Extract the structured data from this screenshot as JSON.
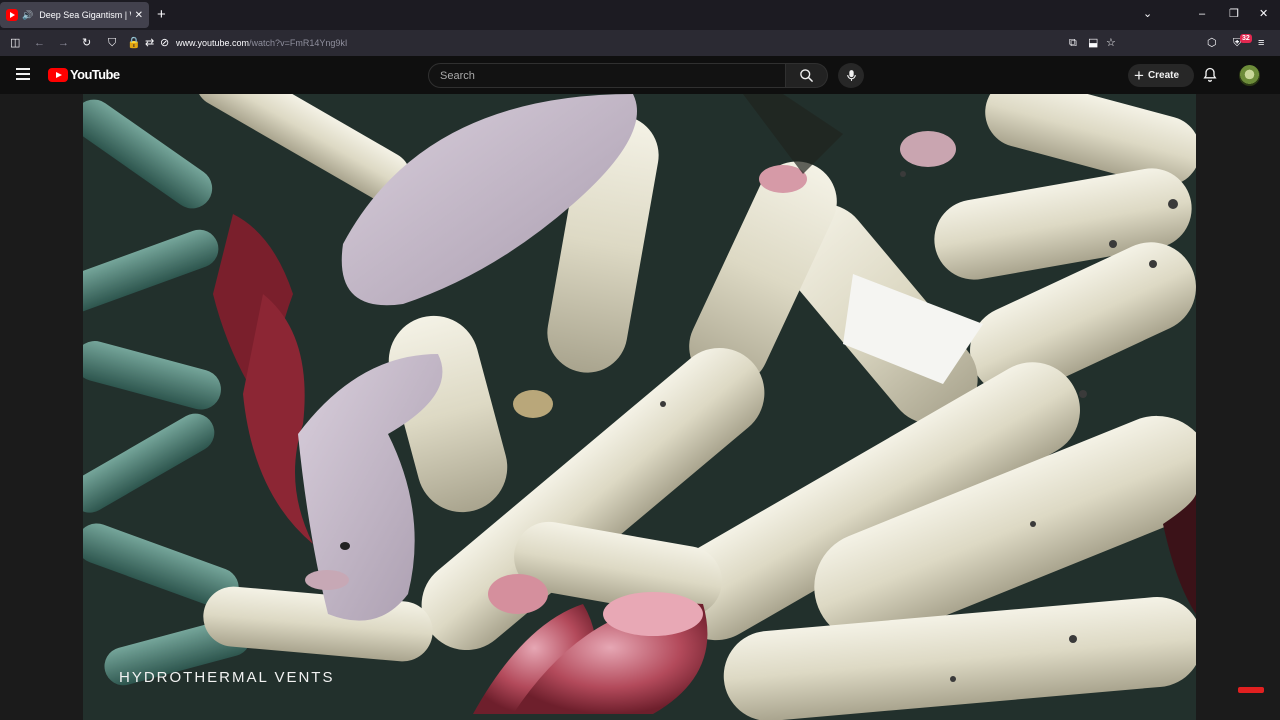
{
  "browser": {
    "tab_title": "Deep Sea Gigantism | Why",
    "new_tab_symbol": "+",
    "url_host": "www.youtube.com",
    "url_path": "/watch?v=FmR14Yng9kI",
    "extension_badge": "32"
  },
  "youtube": {
    "logo_text": "YouTube",
    "search_placeholder": "Search",
    "create_label": "Create"
  },
  "video": {
    "caption": "HYDROTHERMAL VENTS"
  },
  "colors": {
    "brand_red": "#ff0000",
    "background": "#0f0f0f"
  }
}
